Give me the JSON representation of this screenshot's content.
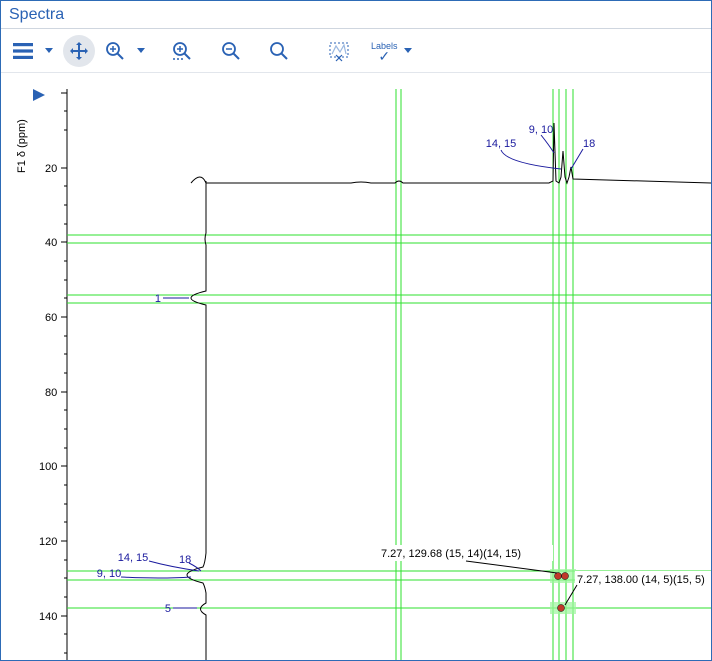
{
  "title": "Spectra",
  "toolbar": {
    "menu": "menu",
    "pan": "pan",
    "zoom_in": "zoom-in",
    "zoom_box": "zoom-box",
    "zoom_out": "zoom-out",
    "zoom_reset": "zoom-reset",
    "selection": "selection",
    "labels_text": "Labels"
  },
  "axes": {
    "y_label": "F1 δ (ppm)",
    "y_ticks": [
      "20",
      "40",
      "60",
      "80",
      "100",
      "120",
      "140"
    ]
  },
  "trace_top": {
    "peak_labels": {
      "top": "9, 10",
      "left": "14, 15",
      "right": "18"
    }
  },
  "trace_left": {
    "peak_labels": {
      "upper": "14, 15",
      "upper_right": "18",
      "mid": "9, 10",
      "c1": "1",
      "c5": "5"
    }
  },
  "crosspeaks": {
    "a": "7.27, 129.68 (15, 14)(14, 15)",
    "b": "7.27, 138.00 (14, 5)(15, 5)"
  },
  "chart_data": {
    "type": "nmr-2d",
    "title": "Spectra",
    "x_axis_visible": false,
    "y_axis": {
      "label": "F1 δ (ppm)",
      "ticks": [
        20,
        40,
        60,
        80,
        100,
        120,
        140
      ],
      "range_ppm": [
        0,
        150
      ]
    },
    "horizontal_guides_ppm": [
      38,
      40,
      54,
      56,
      128,
      130,
      138
    ],
    "vertical_guides_x_fraction": [
      0.53,
      0.865,
      0.878,
      0.888
    ],
    "crosspeaks": [
      {
        "f2_ppm": 7.27,
        "f1_ppm": 129.68,
        "assignment": "(15, 14)(14, 15)"
      },
      {
        "f2_ppm": 7.27,
        "f1_ppm": 138.0,
        "assignment": "(14, 5)(15, 5)"
      }
    ],
    "top_projection_peaks": [
      {
        "label": "9, 10"
      },
      {
        "label": "14, 15"
      },
      {
        "label": "18"
      }
    ],
    "left_projection_peaks": [
      {
        "label": "1",
        "f1_ppm": 55
      },
      {
        "label": "14, 15",
        "f1_ppm": 126
      },
      {
        "label": "18",
        "f1_ppm": 127
      },
      {
        "label": "9, 10",
        "f1_ppm": 130
      },
      {
        "label": "5",
        "f1_ppm": 139
      }
    ]
  }
}
